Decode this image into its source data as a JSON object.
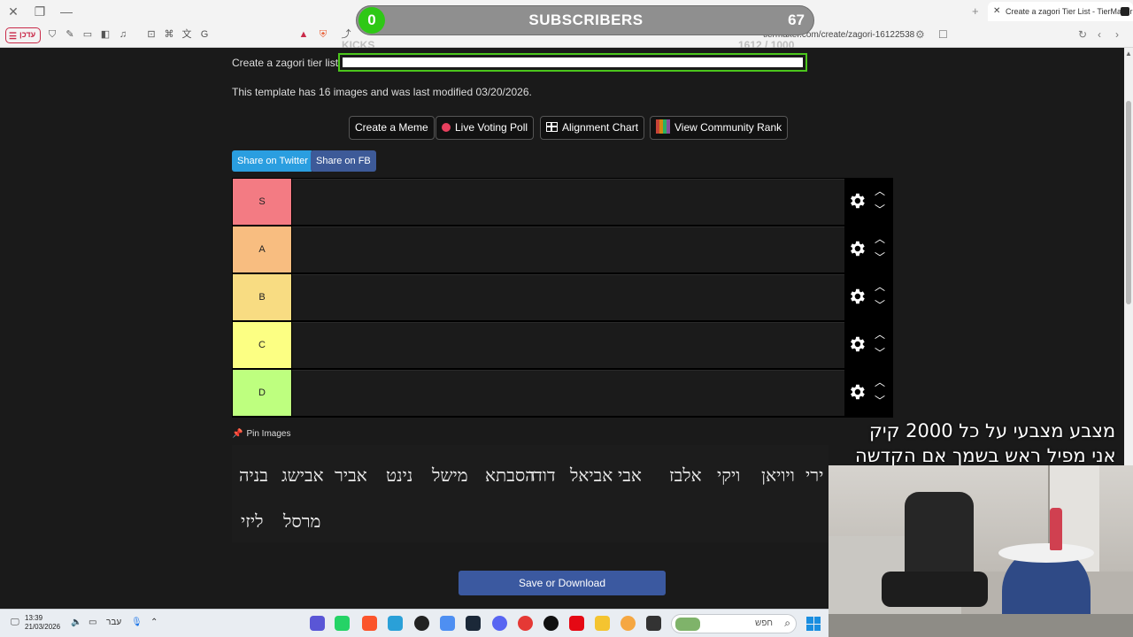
{
  "browser": {
    "tab_title": "Create a zagori Tier List - TierMaker",
    "url": "tiermaker.com/create/zagori-16122538",
    "update_button": "עדכן"
  },
  "overlay": {
    "subscribers_label": "SUBSCRIBERS",
    "subscribers_left": "0",
    "subscribers_right": "67",
    "kicks_label": "KICKS",
    "kicks_count": "1612 / 1000",
    "line1": "מצבע מצבעי על כל 2000 קיק",
    "line2": "אני  מפיל ראש בשמך  אם הקדשה"
  },
  "page": {
    "title_prompt": "Create a zagori tier list.",
    "template_info": "This template has 16 images and was last modified 03/20/2026.",
    "actions": {
      "meme": "Create a Meme",
      "poll": "Live Voting Poll",
      "alignment": "Alignment Chart",
      "community": "View Community Rank"
    },
    "share_twitter": "Share on Twitter",
    "share_fb": "Share on FB",
    "pin_images": "Pin Images",
    "save_download": "Save or Download"
  },
  "tiers": [
    {
      "label": "S",
      "color": "#f37b83"
    },
    {
      "label": "A",
      "color": "#f8bd80"
    },
    {
      "label": "B",
      "color": "#f8dc82"
    },
    {
      "label": "C",
      "color": "#fcff83"
    },
    {
      "label": "D",
      "color": "#beff7f"
    }
  ],
  "pool": {
    "row1": [
      "בניה",
      "אבישג",
      "אביר",
      "נינט",
      "מישל",
      "הסבתא",
      "דודו",
      "אביאל",
      "אבי",
      "אלבז",
      "ויקי",
      "ויויאן",
      "ירי"
    ],
    "row2": [
      "ליזי",
      "מרסל"
    ]
  },
  "taskbar": {
    "time": "13:39",
    "date": "21/03/2026",
    "lang": "עבר",
    "search": "חפש"
  }
}
